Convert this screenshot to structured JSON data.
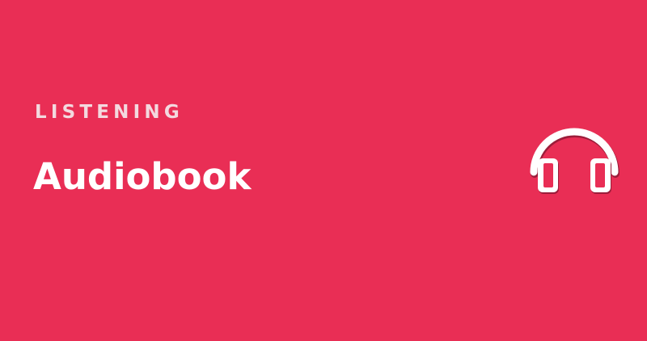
{
  "banner": {
    "kicker": "LISTENING",
    "title": "Audiobook",
    "icon": "headphones-icon",
    "background_color": "#e92e55",
    "text_color": "#ffffff",
    "kicker_color": "#f3d9df"
  }
}
